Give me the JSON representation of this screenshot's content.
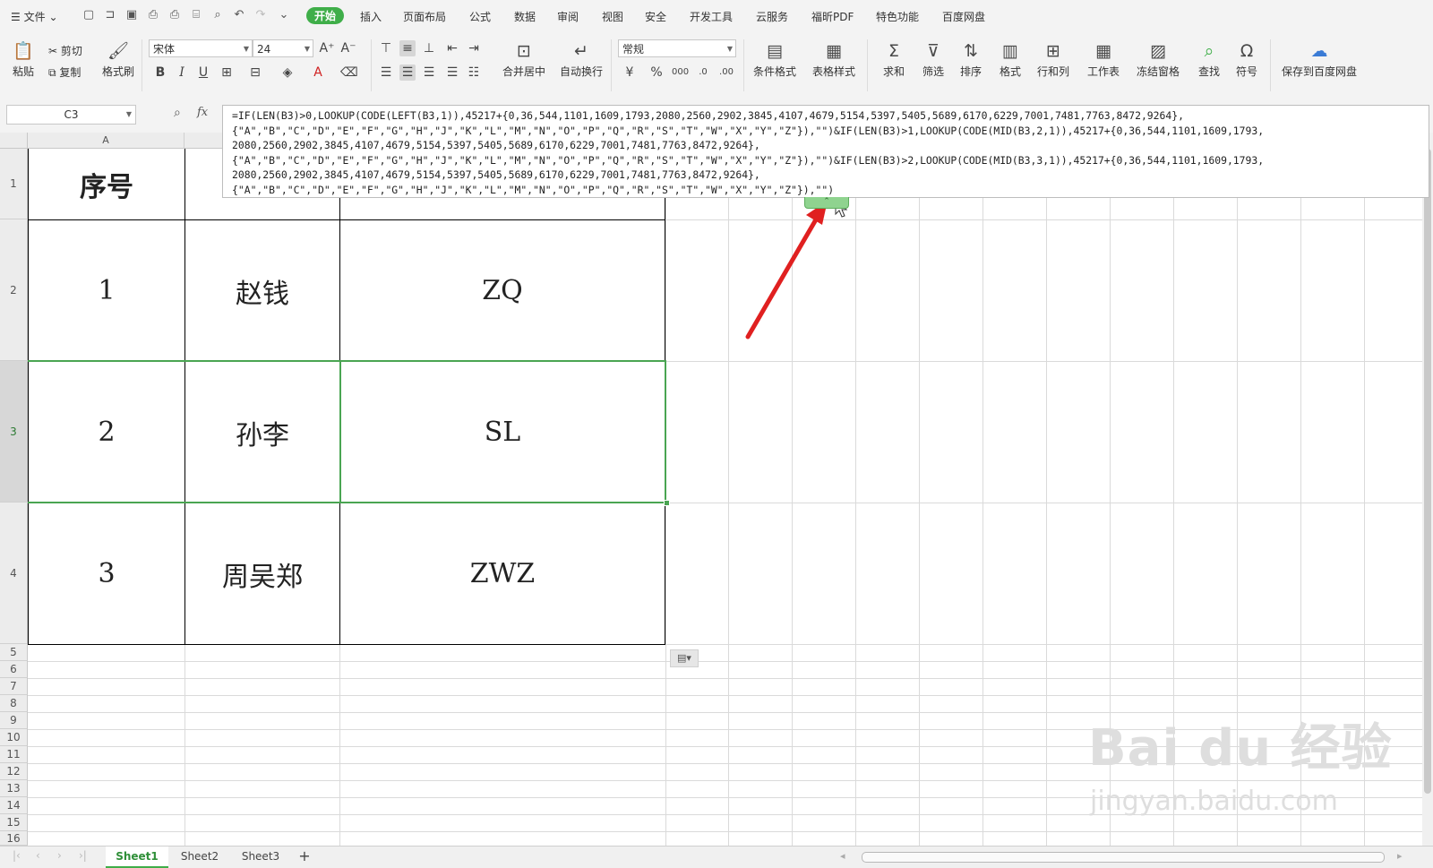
{
  "menubar": {
    "file_label": "文件",
    "tabs": [
      "开始",
      "插入",
      "页面布局",
      "公式",
      "数据",
      "审阅",
      "视图",
      "安全",
      "开发工具",
      "云服务",
      "福昕PDF",
      "特色功能",
      "百度网盘"
    ]
  },
  "ribbon": {
    "paste": "粘贴",
    "cut": "剪切",
    "copy": "复制",
    "format_painter": "格式刷",
    "font_name": "宋体",
    "font_size": "24",
    "merge_center": "合并居中",
    "wrap_text": "自动换行",
    "number_format": "常规",
    "cond_format": "条件格式",
    "table_style": "表格样式",
    "sum": "求和",
    "filter": "筛选",
    "sort": "排序",
    "format": "格式",
    "row_col": "行和列",
    "worksheet": "工作表",
    "freeze": "冻结窗格",
    "find": "查找",
    "symbol": "符号",
    "save_baidu": "保存到百度网盘"
  },
  "formula_bar": {
    "name_box": "C3",
    "fx": "fx",
    "formula_lines": [
      "=IF(LEN(B3)>0,LOOKUP(CODE(LEFT(B3,1)),45217+{0,36,544,1101,1609,1793,2080,2560,2902,3845,4107,4679,5154,5397,5405,5689,6170,6229,7001,7481,7763,8472,9264},",
      "{\"A\",\"B\",\"C\",\"D\",\"E\",\"F\",\"G\",\"H\",\"J\",\"K\",\"L\",\"M\",\"N\",\"O\",\"P\",\"Q\",\"R\",\"S\",\"T\",\"W\",\"X\",\"Y\",\"Z\"}),\"\")&IF(LEN(B3)>1,LOOKUP(CODE(MID(B3,2,1)),45217+{0,36,544,1101,1609,1793,",
      "2080,2560,2902,3845,4107,4679,5154,5397,5405,5689,6170,6229,7001,7481,7763,8472,9264},",
      "{\"A\",\"B\",\"C\",\"D\",\"E\",\"F\",\"G\",\"H\",\"J\",\"K\",\"L\",\"M\",\"N\",\"O\",\"P\",\"Q\",\"R\",\"S\",\"T\",\"W\",\"X\",\"Y\",\"Z\"}),\"\")&IF(LEN(B3)>2,LOOKUP(CODE(MID(B3,3,1)),45217+{0,36,544,1101,1609,1793,",
      "2080,2560,2902,3845,4107,4679,5154,5397,5405,5689,6170,6229,7001,7481,7763,8472,9264},",
      "{\"A\",\"B\",\"C\",\"D\",\"E\",\"F\",\"G\",\"H\",\"J\",\"K\",\"L\",\"M\",\"N\",\"O\",\"P\",\"Q\",\"R\",\"S\",\"T\",\"W\",\"X\",\"Y\",\"Z\"}),\"\")"
    ]
  },
  "sheet": {
    "col_a_header": "A",
    "row_numbers": [
      "1",
      "2",
      "3",
      "4",
      "5",
      "6",
      "7",
      "8",
      "9",
      "10",
      "11",
      "12",
      "13",
      "14",
      "15",
      "16"
    ],
    "table": [
      [
        "序号",
        "",
        ""
      ],
      [
        "1",
        "赵钱",
        "ZQ"
      ],
      [
        "2",
        "孙李",
        "SL"
      ],
      [
        "3",
        "周吴郑",
        "ZWZ"
      ]
    ]
  },
  "sheet_tabs": [
    "Sheet1",
    "Sheet2",
    "Sheet3"
  ],
  "add_sheet": "+",
  "watermark": {
    "brand": "Bai du 经验",
    "url": "jingyan.baidu.com"
  },
  "colors": {
    "accent": "#3fae49",
    "arrow": "#e02020",
    "selection": "#4aa552"
  }
}
